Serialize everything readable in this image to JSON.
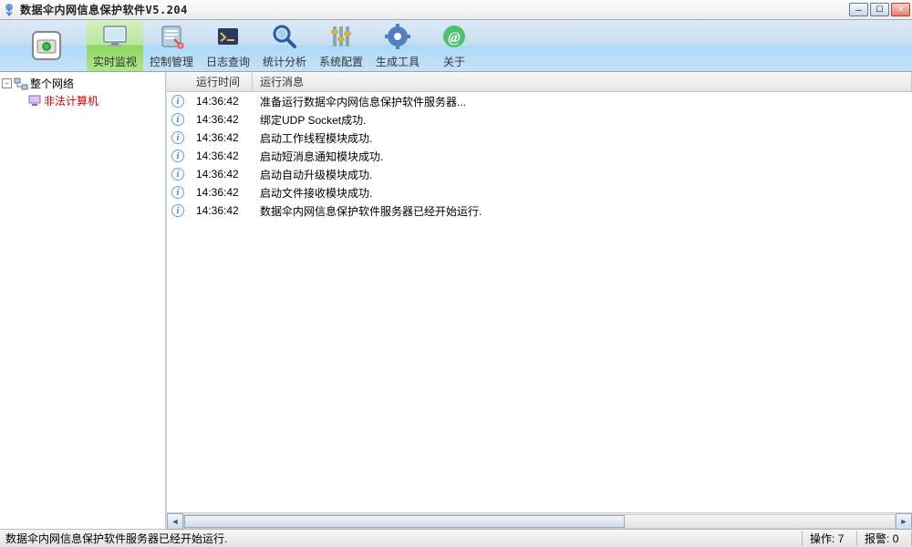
{
  "window": {
    "title": "数据伞内网信息保护软件V5.204"
  },
  "toolbar": {
    "items": [
      {
        "label": "实时监视"
      },
      {
        "label": "控制管理"
      },
      {
        "label": "日志查询"
      },
      {
        "label": "统计分析"
      },
      {
        "label": "系统配置"
      },
      {
        "label": "生成工具"
      },
      {
        "label": "关于"
      }
    ]
  },
  "tree": {
    "root": "整个网络",
    "child": "非法计算机"
  },
  "log": {
    "headers": {
      "time": "运行时间",
      "msg": "运行消息"
    },
    "rows": [
      {
        "time": "14:36:42",
        "msg": "准备运行数据伞内网信息保护软件服务器..."
      },
      {
        "time": "14:36:42",
        "msg": "绑定UDP Socket成功."
      },
      {
        "time": "14:36:42",
        "msg": "启动工作线程模块成功."
      },
      {
        "time": "14:36:42",
        "msg": "启动短消息通知模块成功."
      },
      {
        "time": "14:36:42",
        "msg": "启动自动升级模块成功."
      },
      {
        "time": "14:36:42",
        "msg": "启动文件接收模块成功."
      },
      {
        "time": "14:36:42",
        "msg": "数据伞内网信息保护软件服务器已经开始运行."
      }
    ]
  },
  "status": {
    "message": "数据伞内网信息保护软件服务器已经开始运行.",
    "ops_label": "操作:",
    "ops_value": "7",
    "alarm_label": "报警:",
    "alarm_value": "0"
  }
}
